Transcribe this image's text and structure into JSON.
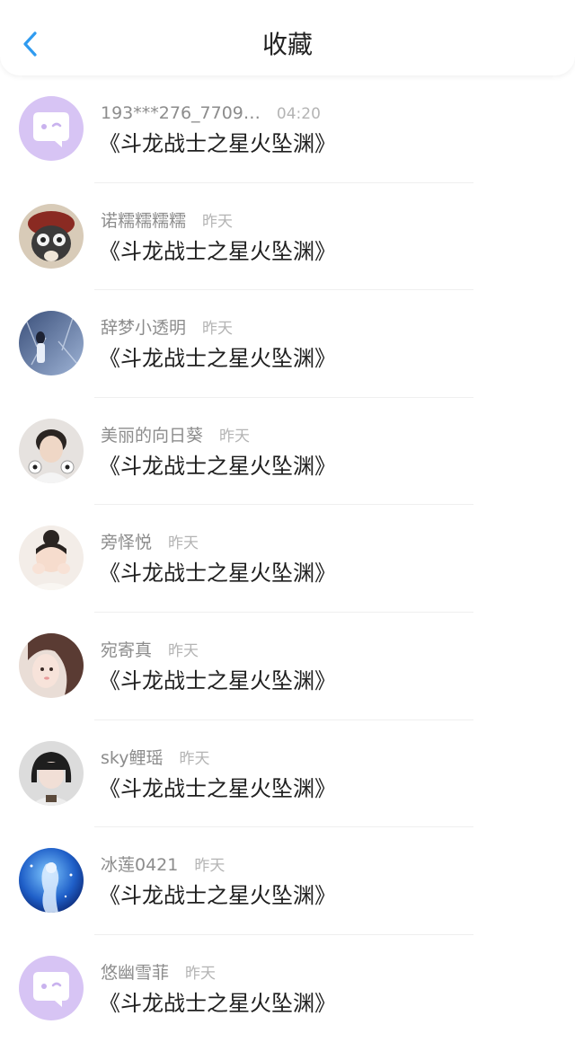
{
  "header": {
    "title": "收藏",
    "back_icon": "chevron-left-icon",
    "accent": "#2f9bf0"
  },
  "items": [
    {
      "name": "193***276_7709…",
      "time": "04:20",
      "title": "《斗龙战士之星火坠渊》",
      "avatar": "chat-bubble-icon"
    },
    {
      "name": "诺糯糯糯糯",
      "time": "昨天",
      "title": "《斗龙战士之星火坠渊》",
      "avatar": "user-photo"
    },
    {
      "name": "辞梦小透明",
      "time": "昨天",
      "title": "《斗龙战士之星火坠渊》",
      "avatar": "user-photo"
    },
    {
      "name": "美丽的向日葵",
      "time": "昨天",
      "title": "《斗龙战士之星火坠渊》",
      "avatar": "user-photo"
    },
    {
      "name": "旁怿悦",
      "time": "昨天",
      "title": "《斗龙战士之星火坠渊》",
      "avatar": "user-photo"
    },
    {
      "name": "宛寄真",
      "time": "昨天",
      "title": "《斗龙战士之星火坠渊》",
      "avatar": "user-photo"
    },
    {
      "name": "sky鲤瑶",
      "time": "昨天",
      "title": "《斗龙战士之星火坠渊》",
      "avatar": "user-photo"
    },
    {
      "name": "冰莲0421",
      "time": "昨天",
      "title": "《斗龙战士之星火坠渊》",
      "avatar": "user-photo"
    },
    {
      "name": "悠幽雪菲",
      "time": "昨天",
      "title": "《斗龙战士之星火坠渊》",
      "avatar": "chat-bubble-icon"
    }
  ]
}
